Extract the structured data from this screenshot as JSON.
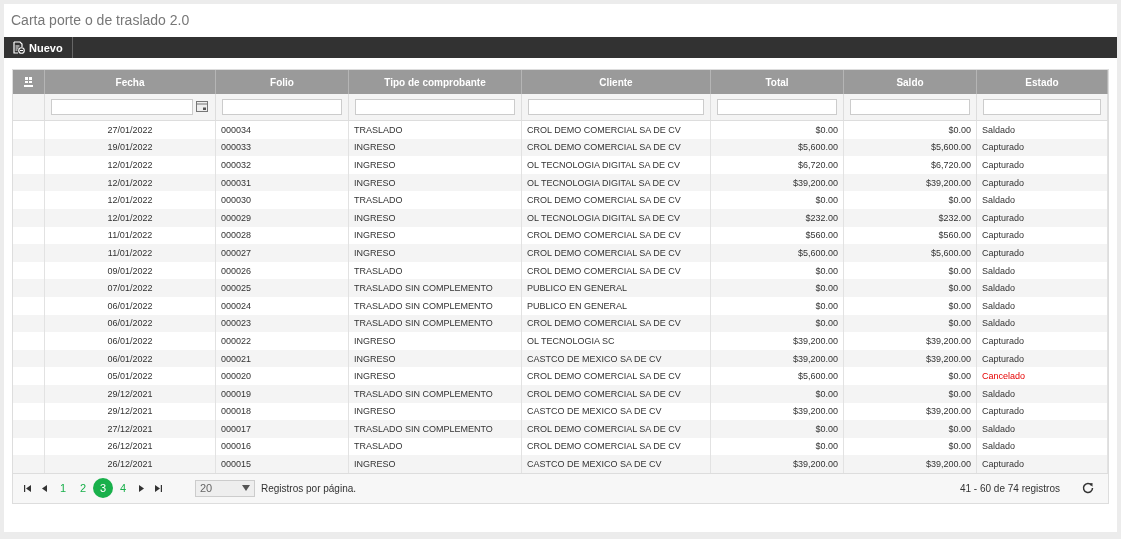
{
  "title": "Carta porte o de traslado 2.0",
  "toolbar": {
    "new_button": "Nuevo"
  },
  "table": {
    "columns": [
      "Fecha",
      "Folio",
      "Tipo de comprobante",
      "Cliente",
      "Total",
      "Saldo",
      "Estado"
    ],
    "rows": [
      {
        "fecha": "27/01/2022",
        "folio": "000034",
        "tipo": "TRASLADO",
        "cliente": "CROL DEMO COMERCIAL SA DE CV",
        "total": "$0.00",
        "saldo": "$0.00",
        "estado": "Saldado",
        "cancelled": false
      },
      {
        "fecha": "19/01/2022",
        "folio": "000033",
        "tipo": "INGRESO",
        "cliente": "CROL DEMO COMERCIAL SA DE CV",
        "total": "$5,600.00",
        "saldo": "$5,600.00",
        "estado": "Capturado",
        "cancelled": false
      },
      {
        "fecha": "12/01/2022",
        "folio": "000032",
        "tipo": "INGRESO",
        "cliente": "OL TECNOLOGIA DIGITAL SA DE CV",
        "total": "$6,720.00",
        "saldo": "$6,720.00",
        "estado": "Capturado",
        "cancelled": false
      },
      {
        "fecha": "12/01/2022",
        "folio": "000031",
        "tipo": "INGRESO",
        "cliente": "OL TECNOLOGIA DIGITAL SA DE CV",
        "total": "$39,200.00",
        "saldo": "$39,200.00",
        "estado": "Capturado",
        "cancelled": false
      },
      {
        "fecha": "12/01/2022",
        "folio": "000030",
        "tipo": "TRASLADO",
        "cliente": "CROL DEMO COMERCIAL SA DE CV",
        "total": "$0.00",
        "saldo": "$0.00",
        "estado": "Saldado",
        "cancelled": false
      },
      {
        "fecha": "12/01/2022",
        "folio": "000029",
        "tipo": "INGRESO",
        "cliente": "OL TECNOLOGIA DIGITAL SA DE CV",
        "total": "$232.00",
        "saldo": "$232.00",
        "estado": "Capturado",
        "cancelled": false
      },
      {
        "fecha": "11/01/2022",
        "folio": "000028",
        "tipo": "INGRESO",
        "cliente": "CROL DEMO COMERCIAL SA DE CV",
        "total": "$560.00",
        "saldo": "$560.00",
        "estado": "Capturado",
        "cancelled": false
      },
      {
        "fecha": "11/01/2022",
        "folio": "000027",
        "tipo": "INGRESO",
        "cliente": "CROL DEMO COMERCIAL SA DE CV",
        "total": "$5,600.00",
        "saldo": "$5,600.00",
        "estado": "Capturado",
        "cancelled": false
      },
      {
        "fecha": "09/01/2022",
        "folio": "000026",
        "tipo": "TRASLADO",
        "cliente": "CROL DEMO COMERCIAL SA DE CV",
        "total": "$0.00",
        "saldo": "$0.00",
        "estado": "Saldado",
        "cancelled": false
      },
      {
        "fecha": "07/01/2022",
        "folio": "000025",
        "tipo": "TRASLADO SIN COMPLEMENTO",
        "cliente": "PUBLICO EN GENERAL",
        "total": "$0.00",
        "saldo": "$0.00",
        "estado": "Saldado",
        "cancelled": false
      },
      {
        "fecha": "06/01/2022",
        "folio": "000024",
        "tipo": "TRASLADO SIN COMPLEMENTO",
        "cliente": "PUBLICO EN GENERAL",
        "total": "$0.00",
        "saldo": "$0.00",
        "estado": "Saldado",
        "cancelled": false
      },
      {
        "fecha": "06/01/2022",
        "folio": "000023",
        "tipo": "TRASLADO SIN COMPLEMENTO",
        "cliente": "CROL DEMO COMERCIAL SA DE CV",
        "total": "$0.00",
        "saldo": "$0.00",
        "estado": "Saldado",
        "cancelled": false
      },
      {
        "fecha": "06/01/2022",
        "folio": "000022",
        "tipo": "INGRESO",
        "cliente": "OL TECNOLOGIA SC",
        "total": "$39,200.00",
        "saldo": "$39,200.00",
        "estado": "Capturado",
        "cancelled": false
      },
      {
        "fecha": "06/01/2022",
        "folio": "000021",
        "tipo": "INGRESO",
        "cliente": "CASTCO DE MEXICO SA DE CV",
        "total": "$39,200.00",
        "saldo": "$39,200.00",
        "estado": "Capturado",
        "cancelled": false
      },
      {
        "fecha": "05/01/2022",
        "folio": "000020",
        "tipo": "INGRESO",
        "cliente": "CROL DEMO COMERCIAL SA DE CV",
        "total": "$5,600.00",
        "saldo": "$0.00",
        "estado": "Cancelado",
        "cancelled": true
      },
      {
        "fecha": "29/12/2021",
        "folio": "000019",
        "tipo": "TRASLADO SIN COMPLEMENTO",
        "cliente": "CROL DEMO COMERCIAL SA DE CV",
        "total": "$0.00",
        "saldo": "$0.00",
        "estado": "Saldado",
        "cancelled": false
      },
      {
        "fecha": "29/12/2021",
        "folio": "000018",
        "tipo": "INGRESO",
        "cliente": "CASTCO DE MEXICO SA DE CV",
        "total": "$39,200.00",
        "saldo": "$39,200.00",
        "estado": "Capturado",
        "cancelled": false
      },
      {
        "fecha": "27/12/2021",
        "folio": "000017",
        "tipo": "TRASLADO SIN COMPLEMENTO",
        "cliente": "CROL DEMO COMERCIAL SA DE CV",
        "total": "$0.00",
        "saldo": "$0.00",
        "estado": "Saldado",
        "cancelled": false
      },
      {
        "fecha": "26/12/2021",
        "folio": "000016",
        "tipo": "TRASLADO",
        "cliente": "CROL DEMO COMERCIAL SA DE CV",
        "total": "$0.00",
        "saldo": "$0.00",
        "estado": "Saldado",
        "cancelled": false
      },
      {
        "fecha": "26/12/2021",
        "folio": "000015",
        "tipo": "INGRESO",
        "cliente": "CASTCO DE MEXICO SA DE CV",
        "total": "$39,200.00",
        "saldo": "$39,200.00",
        "estado": "Capturado",
        "cancelled": false
      }
    ]
  },
  "pager": {
    "pages": [
      {
        "label": "1",
        "selected": false
      },
      {
        "label": "2",
        "selected": false
      },
      {
        "label": "3",
        "selected": true
      },
      {
        "label": "4",
        "selected": false
      }
    ],
    "page_size": "20",
    "page_size_label": "Registros por página.",
    "summary": "41 - 60 de 74 registros"
  }
}
